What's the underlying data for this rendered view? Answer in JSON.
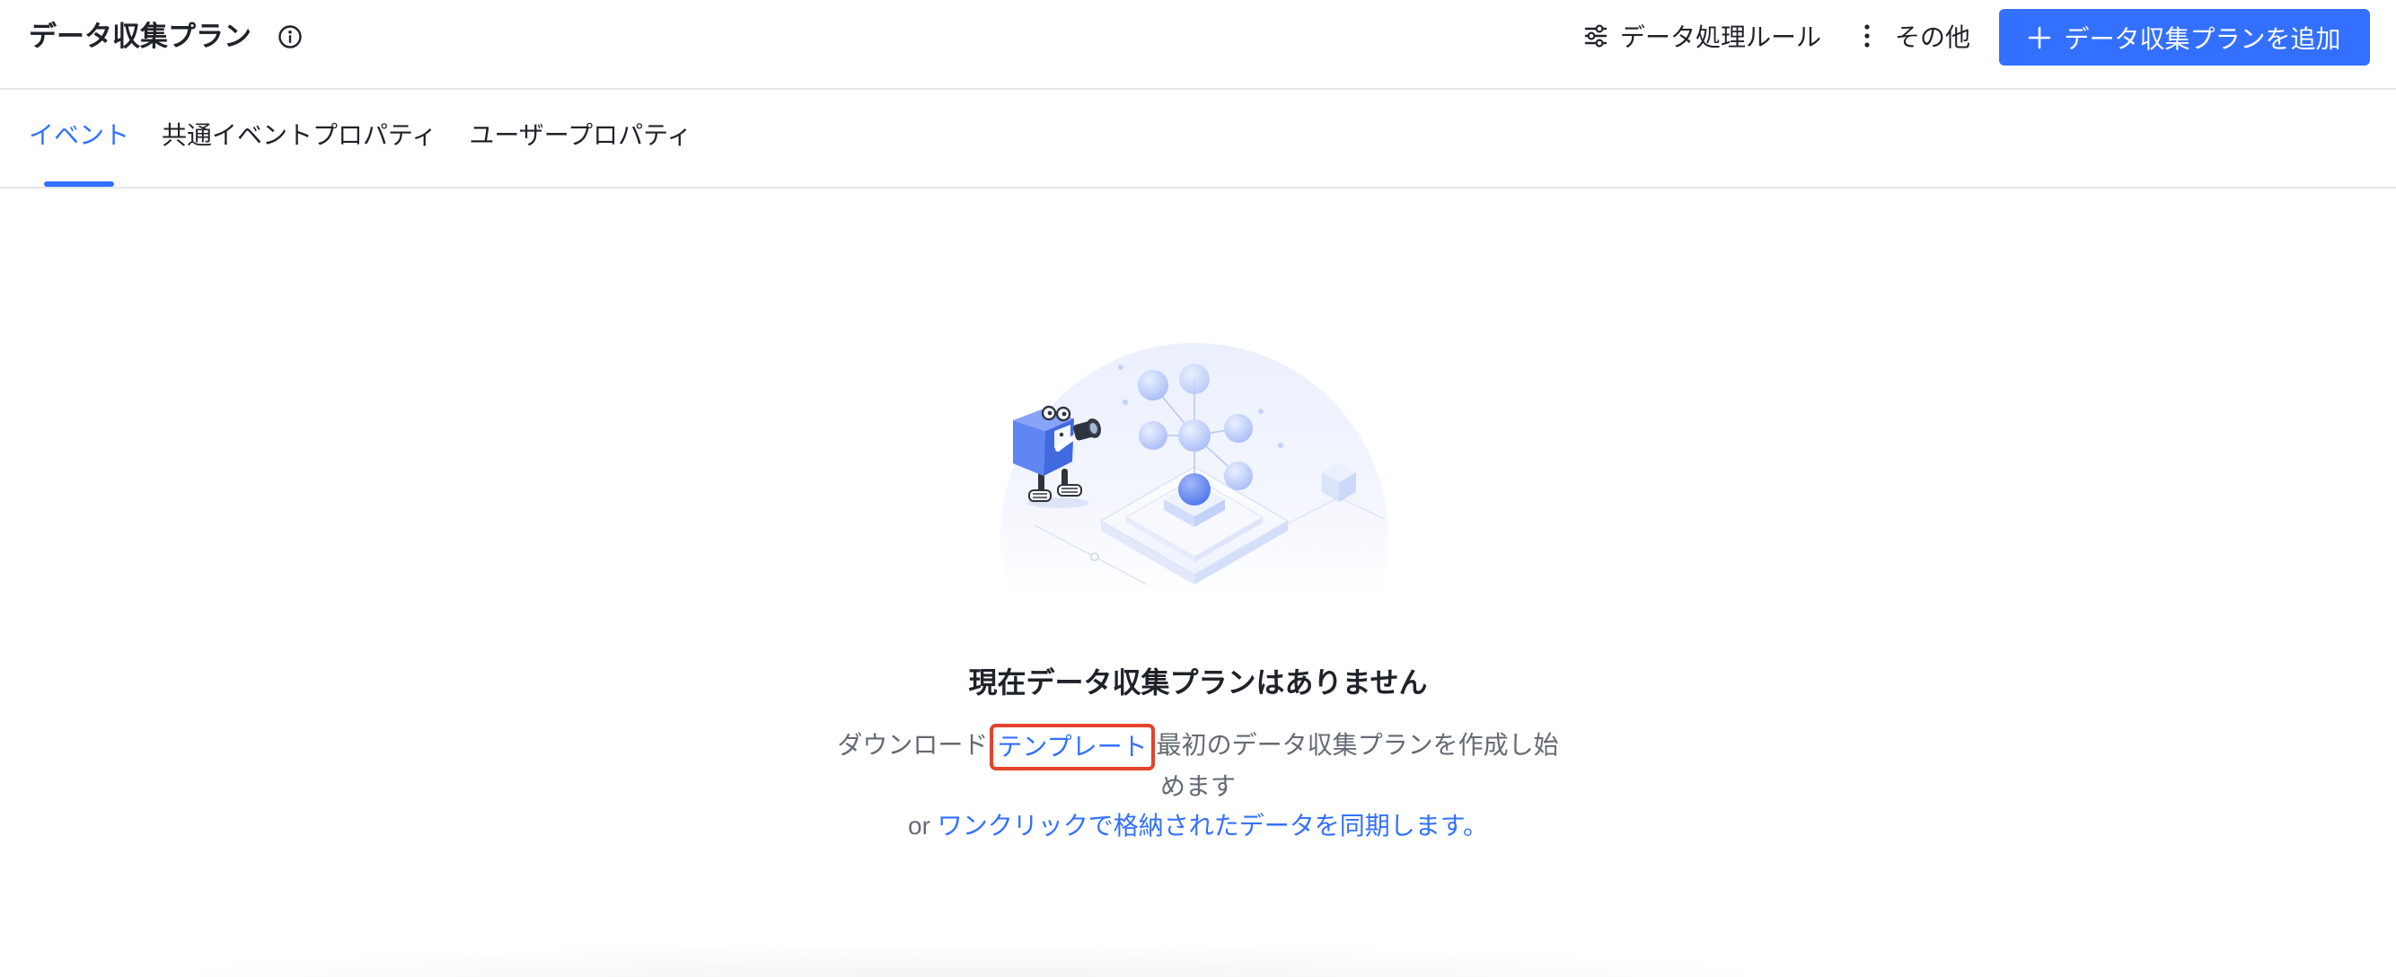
{
  "header": {
    "title": "データ収集プラン",
    "info_icon": "info-circle-icon",
    "actions": {
      "rules_icon": "sliders-icon",
      "rules_label": "データ処理ルール",
      "more_icon": "more-vertical-icon",
      "more_label": "その他",
      "add_icon": "plus-icon",
      "add_label": "データ収集プランを追加"
    }
  },
  "tabs": [
    {
      "label": "イベント",
      "active": true
    },
    {
      "label": "共通イベントプロパティ",
      "active": false
    },
    {
      "label": "ユーザープロパティ",
      "active": false
    }
  ],
  "empty_state": {
    "illustration": "data-network-illustration",
    "title": "現在データ収集プランはありません",
    "description": {
      "prefix": "ダウンロード",
      "template_link": "テンプレート",
      "suffix": "最初のデータ収集プランを作成し始めます",
      "or_label": "or",
      "sync_link": "ワンクリックで格納されたデータを同期します。"
    }
  },
  "colors": {
    "primary": "#3370FF",
    "text": "#1F2329",
    "secondary_text": "#646A73",
    "border": "#E5E6EB",
    "highlight": "#E5432B",
    "button_text": "#FFFFFF"
  }
}
